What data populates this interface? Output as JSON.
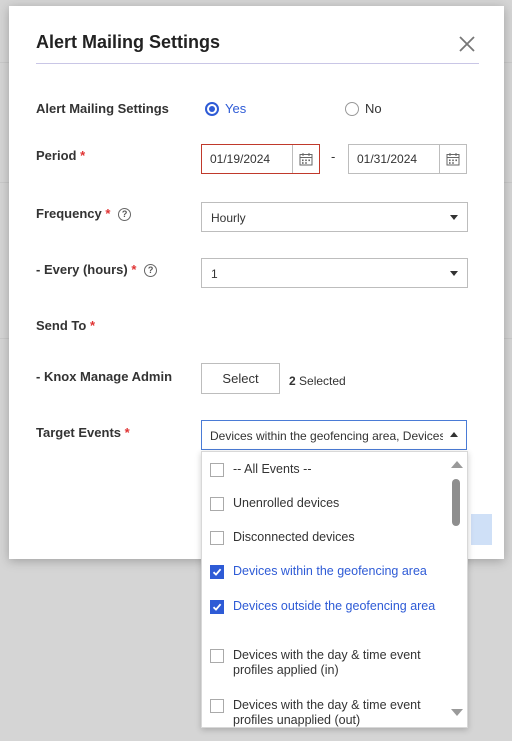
{
  "dialog": {
    "title": "Alert Mailing Settings"
  },
  "form": {
    "mailing": {
      "label": "Alert Mailing Settings",
      "yes_label": "Yes",
      "no_label": "No",
      "selected": "Yes"
    },
    "period": {
      "label": "Period",
      "start": "01/19/2024",
      "separator": "-",
      "end": "01/31/2024"
    },
    "frequency": {
      "label": "Frequency",
      "value": "Hourly"
    },
    "every": {
      "label": "- Every (hours)",
      "value": "1"
    },
    "send_to": {
      "label": "Send To"
    },
    "admin": {
      "label": "- Knox Manage Admin",
      "button_label": "Select",
      "count": "2",
      "count_suffix": "Selected"
    },
    "target_events": {
      "label": "Target Events",
      "value": "Devices within the geofencing area, Devices outside the geofencing area"
    }
  },
  "required_mark": "*",
  "help_glyph": "?",
  "dropdown": {
    "options": [
      {
        "label": "-- All Events --",
        "checked": false
      },
      {
        "label": "Unenrolled devices",
        "checked": false
      },
      {
        "label": "Disconnected devices",
        "checked": false
      },
      {
        "label": "Devices within the geofencing area",
        "checked": true
      },
      {
        "label": "Devices outside the geofencing area",
        "checked": true
      },
      {
        "label": "Devices with the day & time event profiles applied (in)",
        "checked": false
      },
      {
        "label": "Devices with the day & time event profiles unapplied (out)",
        "checked": false
      }
    ]
  },
  "colors": {
    "accent": "#2e5bd6",
    "required": "#e03333",
    "error_border": "#c0392b"
  }
}
